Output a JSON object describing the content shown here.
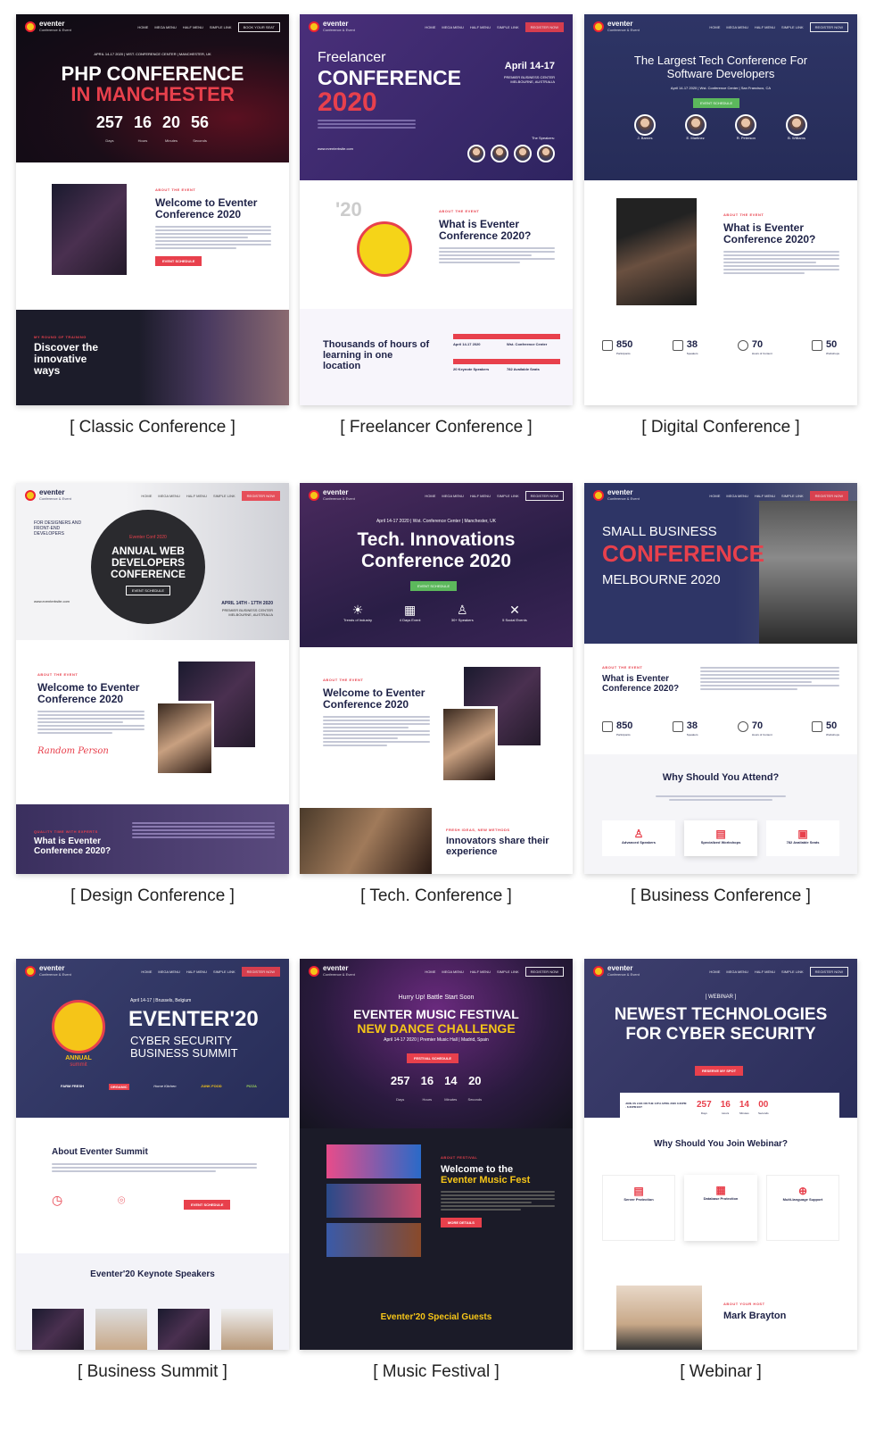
{
  "nav": {
    "logo": "eventer",
    "logo_sub": "Conference & Event",
    "items": [
      "HOME",
      "MEGA MENU",
      "HALF MENU",
      "SIMPLE LINK"
    ],
    "book": "BOOK YOUR SEAT",
    "register": "REGISTER NOW"
  },
  "cards": {
    "classic": {
      "caption": "[ Classic Conference ]",
      "dateline": "APRIL 14-17 2020 | WST. CONFERENCE CENTER | MANCHESTER, UK",
      "title1": "PHP CONFERENCE",
      "title2": "IN MANCHESTER",
      "countdown": [
        {
          "n": "257",
          "l": "Days"
        },
        {
          "n": "16",
          "l": "Hours"
        },
        {
          "n": "20",
          "l": "Minutes"
        },
        {
          "n": "56",
          "l": "Seconds"
        }
      ],
      "eyebrow": "ABOUT THE EVENT",
      "welcome": "Welcome to Eventer Conference 2020",
      "button": "EVENT SCHEDULE",
      "band_eyebrow": "MY ROUND OF TRAINING",
      "band_title": "Discover the innovative ways"
    },
    "freelancer": {
      "caption": "[ Freelancer Conference ]",
      "kicker": "Freelancer",
      "title1": "CONFERENCE",
      "title2": "2020",
      "date": "April 14-17",
      "venue": "PREMIER BUSINESS CENTER MELBOURNE, AUSTRALIA",
      "speakers_label": "The Speakers:",
      "speakers": [
        "J. Barnes",
        "E. Martinez",
        "R. Peterson",
        "B. Williams"
      ],
      "site": "www.eventerbsite.com",
      "badge": "'20",
      "eyebrow": "ABOUT THE EVENT",
      "question": "What is Eventer Conference 2020?",
      "band_title": "Thousands of hours of learning in one location",
      "facts": [
        "April 14-17 2020",
        "Wst. Conference Center",
        "20 Keynote Speakers",
        "782 Available Seats"
      ]
    },
    "digital": {
      "caption": "[ Digital Conference ]",
      "title": "The Largest Tech Conference For Software Developers",
      "sub": "April 14-17 2020 | Wst. Conference Center | San Francisco, CA",
      "button": "EVENT SCHEDULE",
      "speakers": [
        "J. Barnes",
        "E. Martinez",
        "R. Peterson",
        "B. Williams"
      ],
      "eyebrow": "ABOUT THE EVENT",
      "question": "What is Eventer Conference 2020?",
      "stats": [
        {
          "n": "850",
          "l": "Participants"
        },
        {
          "n": "38",
          "l": "Speakers"
        },
        {
          "n": "70",
          "l": "Hours of Content"
        },
        {
          "n": "50",
          "l": "Workshops"
        }
      ]
    },
    "design": {
      "caption": "[ Design Conference ]",
      "side": "FOR DESIGNERS AND FRONT-END DEVELOPERS",
      "circle_kicker": "Eventer Conf 2020",
      "circle_title": "ANNUAL WEB DEVELOPERS CONFERENCE",
      "circle_btn": "EVENT SCHEDULE",
      "date": "APRIL 14TH - 17TH 2020",
      "venue": "PREMIER BUSINESS CENTER MELBOURNE, AUSTRALIA",
      "site": "www.eventerbsite.com",
      "eyebrow": "ABOUT THE EVENT",
      "welcome": "Welcome to Eventer Conference 2020",
      "signature": "Random Person",
      "band_eyebrow": "QUALITY TIME WITH EXPERTS",
      "band_title": "What is Eventer Conference 2020?"
    },
    "tech": {
      "caption": "[ Tech. Conference ]",
      "dateline": "April 14-17 2020 | Wst. Conference Center | Manchester, UK",
      "title1": "Tech. Innovations",
      "title2": "Conference 2020",
      "button": "EVENT SCHEDULE",
      "features": [
        "Trends of Industry",
        "4 Days Event",
        "30+ Speakers",
        "5 Social Events"
      ],
      "eyebrow": "ABOUT THE EVENT",
      "welcome": "Welcome to Eventer Conference 2020",
      "band_eyebrow": "FRESH IDEAS, NEW METHODS",
      "band_title": "Innovators share their experience"
    },
    "business": {
      "caption": "[ Business Conference ]",
      "line1": "SMALL BUSINESS",
      "line2": "CONFERENCE",
      "line3": "MELBOURNE 2020",
      "eyebrow": "ABOUT THE EVENT",
      "question": "What is Eventer Conference 2020?",
      "stats": [
        {
          "n": "850",
          "l": "Participants"
        },
        {
          "n": "38",
          "l": "Speakers"
        },
        {
          "n": "70",
          "l": "Hours of Content"
        },
        {
          "n": "50",
          "l": "Workshops"
        }
      ],
      "why": "Why Should You Attend?",
      "tiles": [
        "Advanced Speakers",
        "Specialized Workshops",
        "782 Available Seats"
      ]
    },
    "summit": {
      "caption": "[ Business Summit ]",
      "dateline": "April 14-17 | Brussels, Belgium",
      "title": "EVENTER'20",
      "sub1": "CYBER SECURITY",
      "sub2": "BUSINESS SUMMIT",
      "badge1": "ANNUAL",
      "badge2": "summit",
      "sponsors": [
        "FARM FRESH",
        "ORGANIC",
        "Home Kitchen",
        "JUNK FOOD",
        "PIZZA"
      ],
      "about": "About Eventer Summit",
      "button": "EVENT SCHEDULE",
      "keynote": "Eventer'20 Keynote Speakers"
    },
    "music": {
      "caption": "[ Music Festival ]",
      "kicker": "Hurry Up! Battle Start Soon",
      "title1": "EVENTER MUSIC FESTIVAL",
      "title2": "NEW DANCE CHALLENGE",
      "sub": "April 14-17 2020 | Premier Music Hall | Madrid, Spain",
      "button": "FESTIVAL SCHEDULE",
      "countdown": [
        {
          "n": "257",
          "l": "Days"
        },
        {
          "n": "16",
          "l": "Hours"
        },
        {
          "n": "14",
          "l": "Minutes"
        },
        {
          "n": "20",
          "l": "Seconds"
        }
      ],
      "eyebrow": "ABOUT FESTIVAL",
      "welcome1": "Welcome to the",
      "welcome2": "Eventer Music Fest",
      "more": "MORE DETAILS",
      "guests": "Eventer'20 Special Guests"
    },
    "webinar": {
      "caption": "[ Webinar ]",
      "kicker": "[ WEBINAR ]",
      "title1": "NEWEST TECHNOLOGIES",
      "title2": "FOR CYBER SECURITY",
      "button": "RESERVE MY SPOT",
      "join": "JOIN US LIVE ON THE 14TH APRIL 2020 3:30PM - 6:30PM EST",
      "countdown": [
        {
          "n": "257",
          "l": "Days"
        },
        {
          "n": "16",
          "l": "Hours"
        },
        {
          "n": "14",
          "l": "Minutes"
        },
        {
          "n": "00",
          "l": "Seconds"
        }
      ],
      "why": "Why Should You Join Webinar?",
      "tiles": [
        "Server Protection",
        "Database Protection",
        "Multi-language Support"
      ],
      "host_eyebrow": "ABOUT YOUR HOST",
      "host": "Mark Brayton"
    }
  },
  "colors": {
    "red": "#e8404c",
    "navy": "#1e2247",
    "purple": "#3b2f6b",
    "yellow": "#f5c518"
  }
}
